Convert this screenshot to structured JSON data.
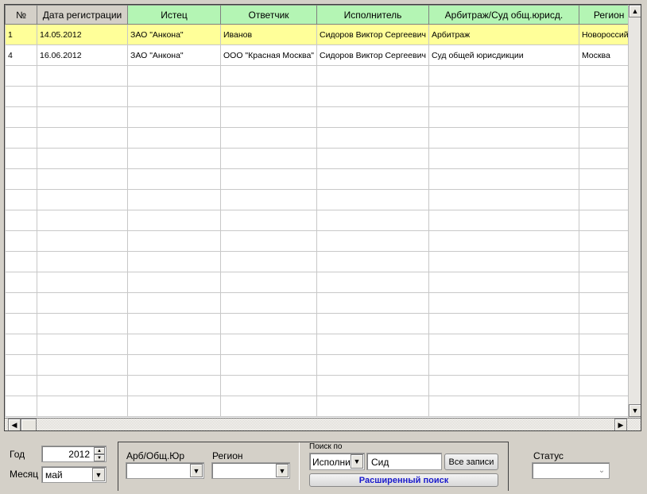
{
  "grid": {
    "columns": [
      "№",
      "Дата регистрации",
      "Истец",
      "Ответчик",
      "Исполнитель",
      "Арбитраж/Суд общ.юрисд.",
      "Регион"
    ],
    "rows": [
      [
        "1",
        "14.05.2012",
        "ЗАО \"Анкона\"",
        "Иванов",
        "Сидоров Виктор Сергеевич",
        "Арбитраж",
        "Новороссийск"
      ],
      [
        "4",
        "16.06.2012",
        "ЗАО \"Анкона\"",
        "ООО \"Красная Москва\"",
        "Сидоров Виктор Сергеевич",
        "Суд общей юрисдикции",
        "Москва"
      ]
    ],
    "selected_row": 0
  },
  "filters": {
    "year_label": "Год",
    "year_value": "2012",
    "month_label": "Месяц",
    "month_value": "май",
    "court_label": "Арб/Общ.Юр",
    "court_value": "",
    "region_label": "Регион",
    "region_value": "",
    "search_label": "Поиск по",
    "search_field": "Исполнитель",
    "search_value": "Сид",
    "all_records": "Все записи",
    "advanced_search": "Расширенный поиск",
    "status_label": "Статус",
    "status_value": ""
  },
  "colors": {
    "header": "#b4f5b4",
    "selected": "#ffff99",
    "advanced_text": "#1a1acc"
  }
}
